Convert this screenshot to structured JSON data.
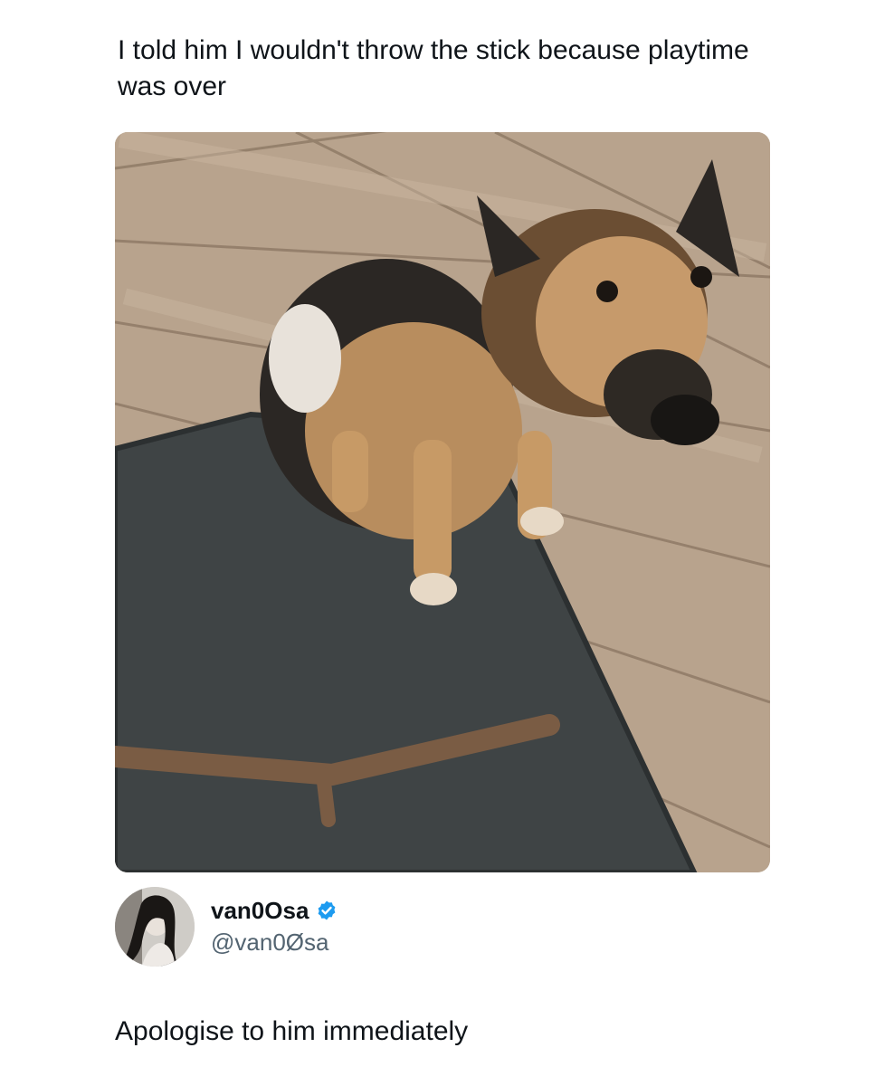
{
  "post": {
    "caption": "I told him I wouldn't throw the stick because playtime was over",
    "image_subject": "dog-photo"
  },
  "author": {
    "display_name": "van0Osa",
    "handle": "@van0Øsa",
    "verified": true,
    "verified_color": "#1d9bf0"
  },
  "reply": {
    "text": "Apologise to him immediately"
  },
  "icons": {
    "verified": "verified-badge-icon",
    "avatar": "user-avatar"
  }
}
